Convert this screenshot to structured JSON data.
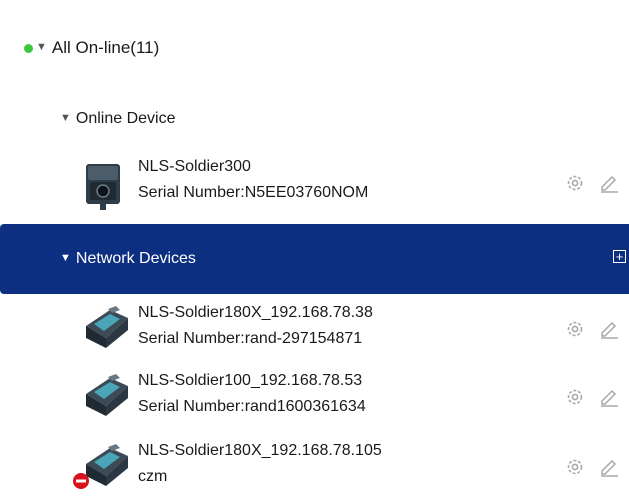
{
  "tree": {
    "root_label": "All On-line(11)",
    "groups": [
      {
        "label": "Online Device",
        "devices": [
          {
            "name": "NLS-Soldier300",
            "serial": "Serial Number:N5EE03760NOM",
            "icon": "fixed-scanner-icon"
          }
        ]
      },
      {
        "label": "Network Devices",
        "selected": true,
        "add_button_label": "+",
        "devices": [
          {
            "name": "NLS-Soldier180X_192.168.78.38",
            "serial": "Serial Number:rand-297154871",
            "icon": "network-scanner-icon"
          },
          {
            "name": "NLS-Soldier100_192.168.78.53",
            "serial": "Serial Number:rand1600361634",
            "icon": "network-scanner-icon"
          },
          {
            "name": "NLS-Soldier180X_192.168.78.105",
            "serial": "czm",
            "icon": "network-scanner-icon",
            "status": "error"
          }
        ]
      }
    ]
  },
  "colors": {
    "online_dot": "#3ec63e",
    "selected_bg": "#0d2f82",
    "action_icon": "#a8a8a8",
    "error_badge": "#d8121a"
  }
}
